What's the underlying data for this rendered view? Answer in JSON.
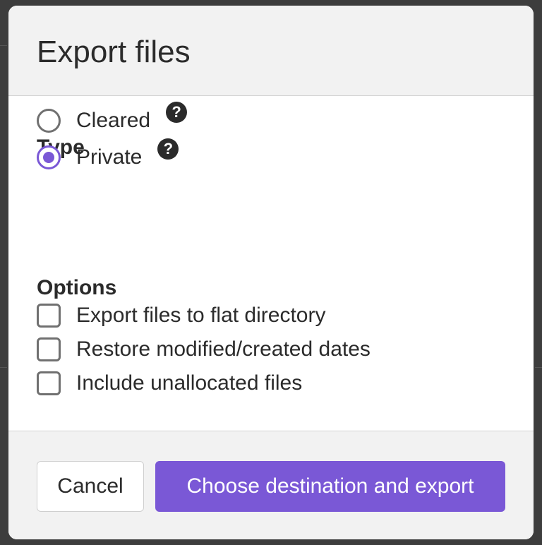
{
  "dialog": {
    "title": "Export files"
  },
  "type_section": {
    "title": "Type",
    "options": [
      {
        "label": "Cleared",
        "selected": false,
        "help_icon": "question-circle-icon"
      },
      {
        "label": "Private",
        "selected": true,
        "help_icon": "question-circle-icon"
      }
    ]
  },
  "options_section": {
    "title": "Options",
    "checkboxes": [
      {
        "label": "Export files to flat directory",
        "checked": false
      },
      {
        "label": "Restore modified/created dates",
        "checked": false
      },
      {
        "label": "Include unallocated files",
        "checked": false
      }
    ]
  },
  "footer": {
    "cancel_label": "Cancel",
    "primary_label": "Choose destination and export"
  },
  "colors": {
    "accent": "#7a58d6",
    "header_bg": "#f2f2f2",
    "text": "#2b2b2b",
    "backdrop": "#3d3d3d"
  }
}
